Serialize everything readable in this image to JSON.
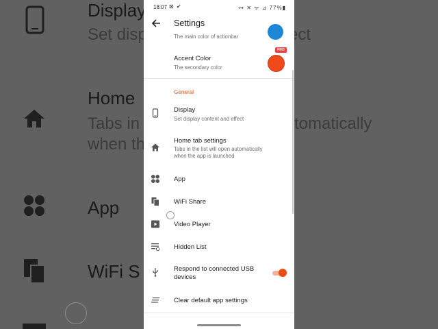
{
  "background": {
    "display_title": "Display",
    "display_sub": "Set disp",
    "display_sub_right": "ect",
    "home_title": "Home",
    "home_sub_line1": "Tabs in",
    "home_sub_line1_right": "tomatically",
    "home_sub_line2": "when th",
    "app_title": "App",
    "wifi_title": "WiFi S"
  },
  "status_bar": {
    "time": "18:07",
    "left_icons": "⊠ ✔",
    "right_icons": "⊶ ✕ ᯤ ⊿ 77%▮"
  },
  "toolbar": {
    "title": "Settings"
  },
  "theme": {
    "primary_subtitle": "The main color of actionbar",
    "accent_title": "Accent Color",
    "accent_subtitle": "The secondary color",
    "pro_badge": "PRO"
  },
  "general": {
    "section_title": "General",
    "items": [
      {
        "title": "Display",
        "subtitle": "Set display content and effect"
      },
      {
        "title": "Home tab settings",
        "subtitle": "Tabs in the list will open automatically when the app is launched"
      },
      {
        "title": "App"
      },
      {
        "title": "WiFi Share"
      },
      {
        "title": "Video Player"
      },
      {
        "title": "Hidden List"
      },
      {
        "title": "Respond to connected USB devices"
      },
      {
        "title": "Clear default app settings"
      }
    ]
  },
  "colors": {
    "primary_circle": "#1e88d6",
    "accent_circle": "#f04a1a",
    "accent": "#e2541c"
  }
}
